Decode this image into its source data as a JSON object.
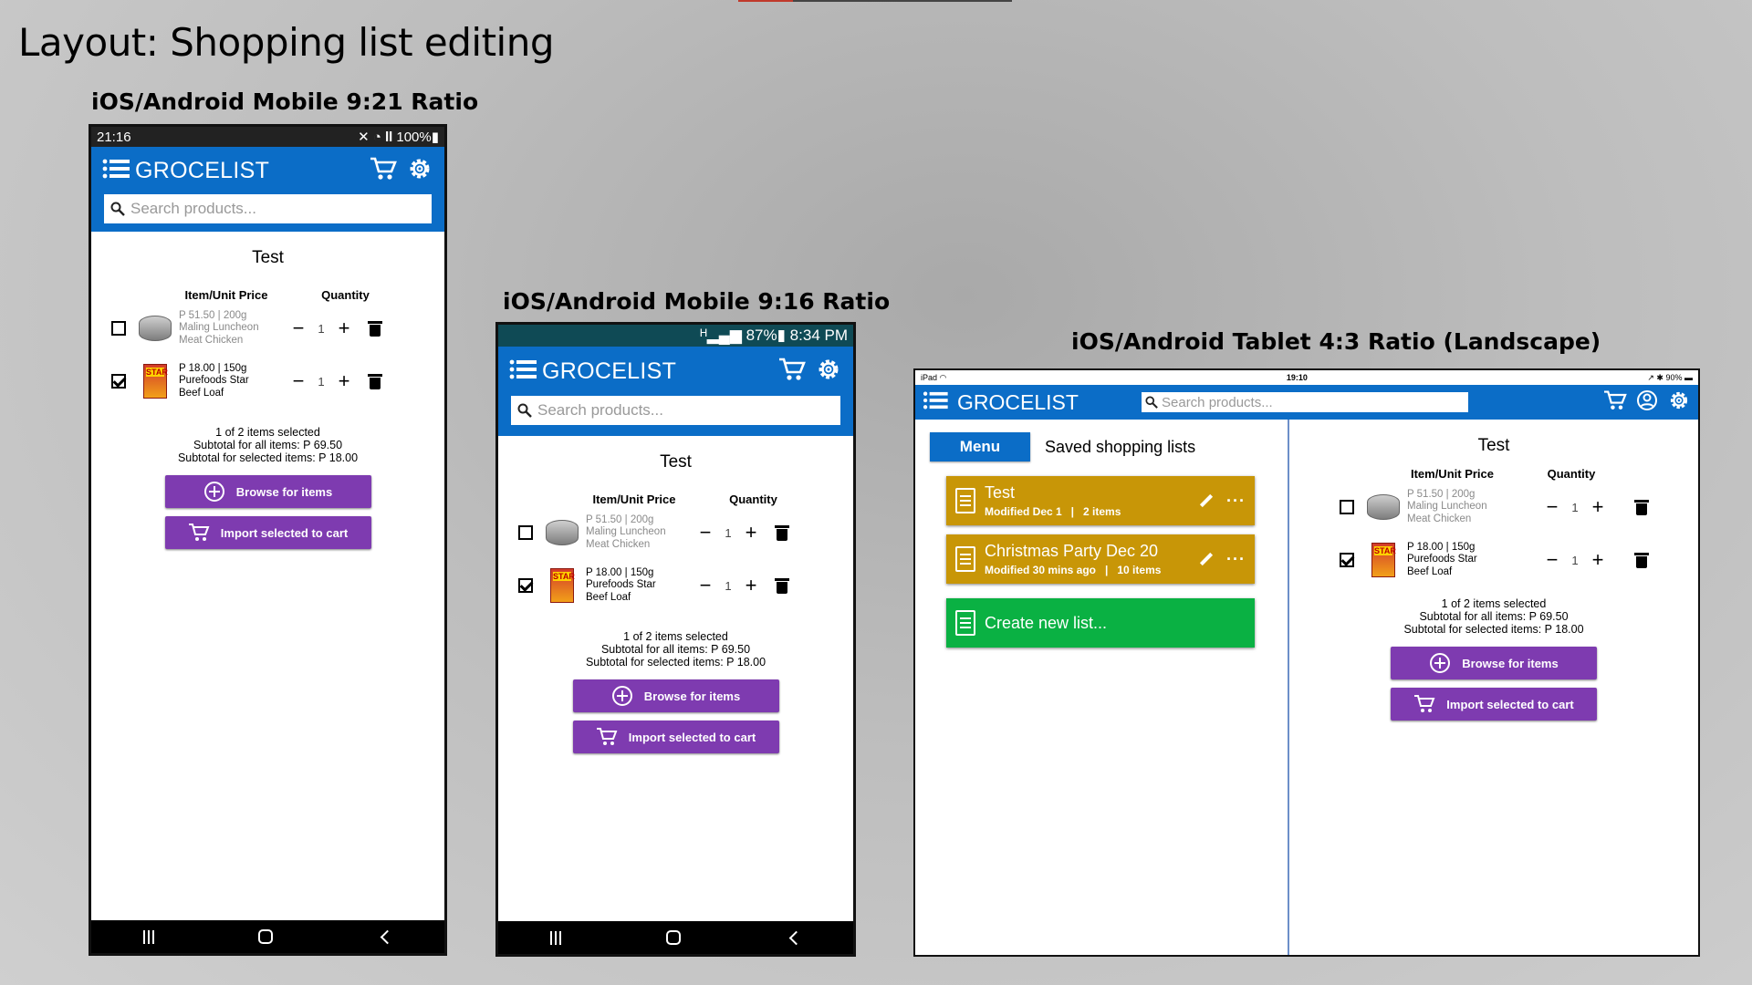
{
  "page_title": "Layout: Shopping list editing",
  "sections": {
    "mobile_921": "iOS/Android Mobile 9:21 Ratio",
    "mobile_916": "iOS/Android Mobile 9:16 Ratio",
    "tablet_43": "iOS/Android Tablet 4:3 Ratio (Landscape)"
  },
  "phone1": {
    "status_time": "21:16",
    "status_right": "✕ ◔ 𝐥𝐥 100%▮"
  },
  "phone2": {
    "status_right": "ᴴ▂▄▆ 87%▮ 8:34 PM"
  },
  "tablet": {
    "status_left": "iPad ◠",
    "status_time": "19:10",
    "status_right": "↗ ✱ 90% ▬"
  },
  "app": {
    "title": "GROCELIST",
    "search_placeholder": "Search products..."
  },
  "list": {
    "name": "Test",
    "col_item": "Item/Unit Price",
    "col_qty": "Quantity",
    "items": [
      {
        "price": "P 51.50 | 200g",
        "name1": "Maling Luncheon",
        "name2": "Meat Chicken",
        "qty": "1",
        "checked": false
      },
      {
        "price": "P 18.00 | 150g",
        "name1": "Purefoods Star",
        "name2": "Beef Loaf",
        "qty": "1",
        "checked": true
      }
    ],
    "summary1": "1 of 2 items selected",
    "summary2": "Subtotal for all items: P 69.50",
    "summary3": "Subtotal for selected items: P 18.00",
    "browse_label": "Browse for items",
    "import_label": "Import selected to cart",
    "star_label": "STAR"
  },
  "saved": {
    "menu_label": "Menu",
    "heading": "Saved shopping lists",
    "lists": [
      {
        "name": "Test",
        "meta": "Modified Dec 1   |   2 items"
      },
      {
        "name": "Christmas Party Dec 20",
        "meta": "Modified 30 mins ago   |   10 items"
      }
    ],
    "create_label": "Create new list...",
    "more": "···"
  },
  "colors": {
    "appbar": "#0b6dc7",
    "button": "#7e3bb0",
    "card": "#c89607",
    "create": "#0ab143"
  }
}
